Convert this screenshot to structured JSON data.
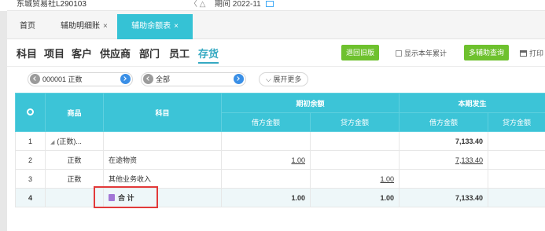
{
  "topbar": {
    "company": "东城贸易社L290103",
    "controls": "〈 △",
    "period_label": "期间",
    "period_value": "2022-11"
  },
  "tabs": {
    "home": "首页",
    "detail": "辅助明细账",
    "balance": "辅助余额表",
    "close_glyph": "×"
  },
  "categories": [
    "科目",
    "项目",
    "客户",
    "供应商",
    "部门",
    "员工",
    "存货"
  ],
  "toolbar": {
    "back_old": "退回旧版",
    "show_year": "显示本年累计",
    "aux_query": "多辅助查询",
    "print": "打印"
  },
  "filters": {
    "account": "000001 正数",
    "scope": "全部",
    "expand": "展开更多"
  },
  "table": {
    "headers": {
      "goods": "商品",
      "subject": "科目",
      "opening": "期初余额",
      "current": "本期发生",
      "debit": "借方金额",
      "credit": "贷方金额"
    },
    "rows": [
      {
        "no": "1",
        "goods": "(正数)...",
        "subject": "",
        "open_debit": "",
        "open_credit": "",
        "cur_debit": "7,133.40",
        "cur_credit": ""
      },
      {
        "no": "2",
        "goods": "正数",
        "subject": "在途物资",
        "open_debit": "1.00",
        "open_credit": "",
        "cur_debit": "7,133.40",
        "cur_credit": ""
      },
      {
        "no": "3",
        "goods": "正数",
        "subject": "其他业务收入",
        "open_debit": "",
        "open_credit": "1.00",
        "cur_debit": "",
        "cur_credit": ""
      },
      {
        "no": "4",
        "goods": "",
        "subject": "合 计",
        "open_debit": "1.00",
        "open_credit": "1.00",
        "cur_debit": "7,133.40",
        "cur_credit": ""
      }
    ]
  },
  "colors": {
    "accent": "#3cc4d7",
    "green_button": "#6ec12e",
    "highlight_box": "#e23a3a"
  }
}
